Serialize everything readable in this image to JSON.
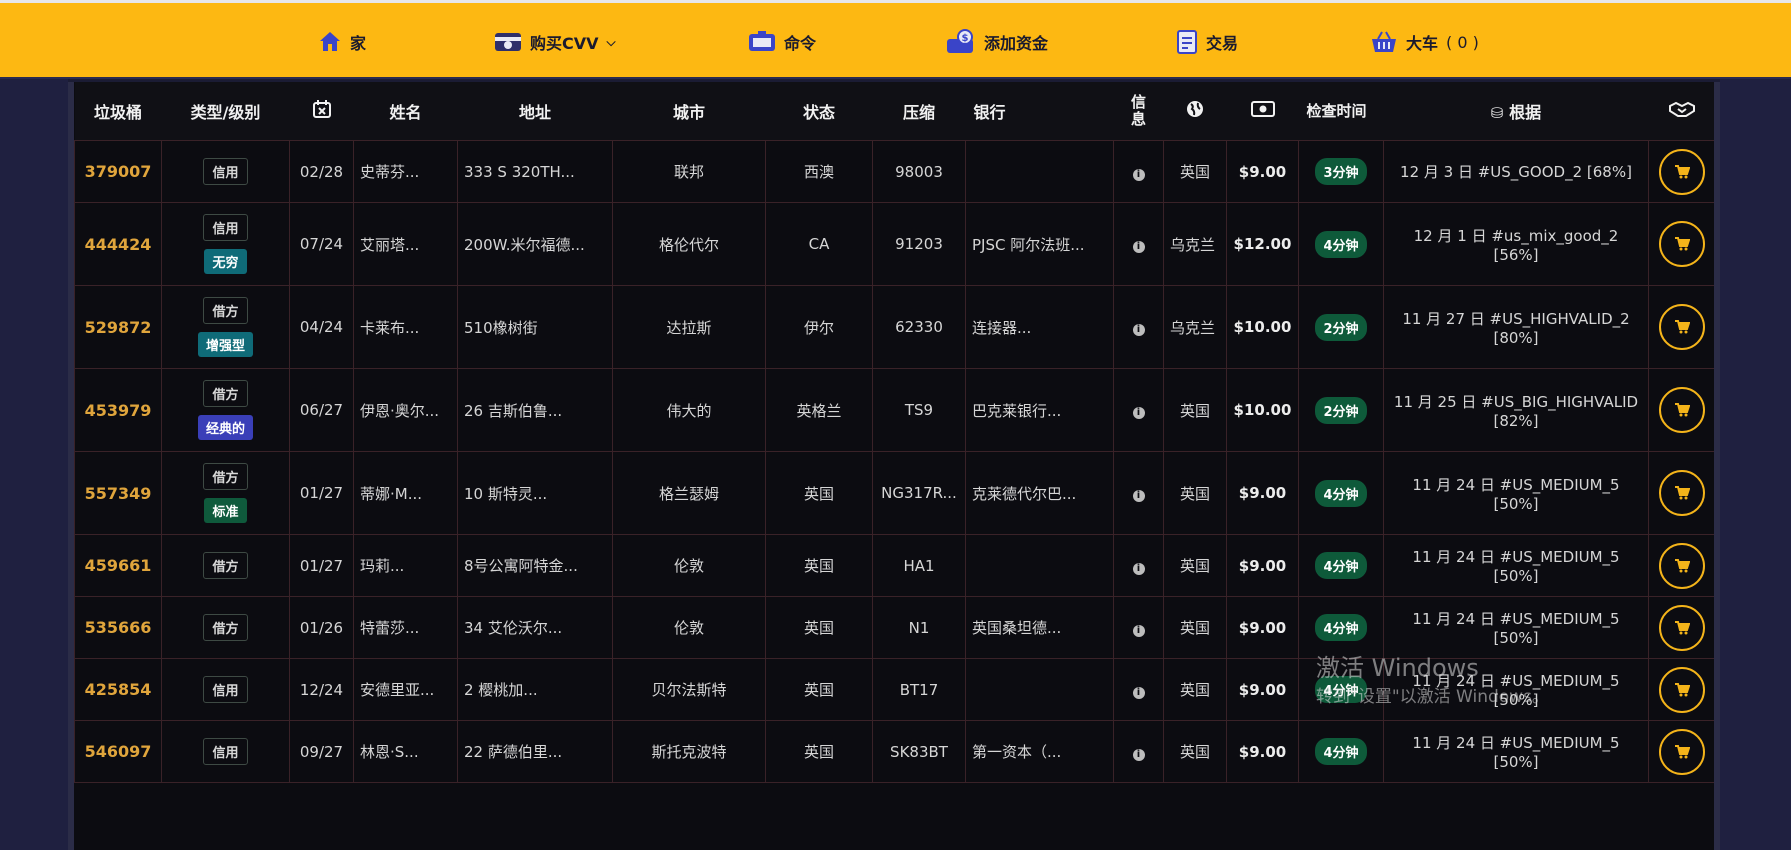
{
  "nav": {
    "home": "家",
    "buy_cvv": "购买CVV",
    "orders": "命令",
    "add_funds": "添加资金",
    "transactions": "交易",
    "cart": "大车",
    "cart_count": "( 0 )"
  },
  "table": {
    "headers": {
      "bin": "垃圾桶",
      "type_level": "类型/级别",
      "name": "姓名",
      "address": "地址",
      "city": "城市",
      "state": "状态",
      "zip": "压缩",
      "bank": "银行",
      "info": "信息",
      "checked": "检查时间",
      "base": "根据"
    },
    "rows": [
      {
        "bin": "379007",
        "type": "信用",
        "level": "",
        "level_color": "",
        "exp": "02/28",
        "name": "史蒂芬...",
        "address": "333 S 320TH...",
        "city": "联邦",
        "state": "西澳",
        "zip": "98003",
        "bank": "",
        "country": "英国",
        "price": "$9.00",
        "checked": "3分钟",
        "base": "12 月 3 日 #US_GOOD_2 [68%]"
      },
      {
        "bin": "444424",
        "type": "信用",
        "level": "无穷",
        "level_color": "#0f6b78",
        "exp": "07/24",
        "name": "艾丽塔...",
        "address": "200W.米尔福德...",
        "city": "格伦代尔",
        "state": "CA",
        "zip": "91203",
        "bank": "PJSC 阿尔法班...",
        "country": "乌克兰",
        "price": "$12.00",
        "checked": "4分钟",
        "base": "12 月 1 日 #us_mix_good_2 [56%]"
      },
      {
        "bin": "529872",
        "type": "借方",
        "level": "增强型",
        "level_color": "#0f6b78",
        "exp": "04/24",
        "name": "卡莱布...",
        "address": "510橡树街",
        "city": "达拉斯",
        "state": "伊尔",
        "zip": "62330",
        "bank": "连接器...",
        "country": "乌克兰",
        "price": "$10.00",
        "checked": "2分钟",
        "base": "11 月 27 日 #US_HIGHVALID_2 [80%]"
      },
      {
        "bin": "453979",
        "type": "借方",
        "level": "经典的",
        "level_color": "#3a3fb8",
        "exp": "06/27",
        "name": "伊恩·奥尔...",
        "address": "26 吉斯伯鲁...",
        "city": "伟大的",
        "state": "英格兰",
        "zip": "TS9",
        "bank": "巴克莱银行...",
        "country": "英国",
        "price": "$10.00",
        "checked": "2分钟",
        "base": "11 月 25 日 #US_BIG_HIGHVALID [82%]"
      },
      {
        "bin": "557349",
        "type": "借方",
        "level": "标准",
        "level_color": "#0f5a3c",
        "exp": "01/27",
        "name": "蒂娜·M...",
        "address": "10 斯特灵...",
        "city": "格兰瑟姆",
        "state": "英国",
        "zip": "NG317R...",
        "bank": "克莱德代尔巴...",
        "country": "英国",
        "price": "$9.00",
        "checked": "4分钟",
        "base": "11 月 24 日 #US_MEDIUM_5 [50%]"
      },
      {
        "bin": "459661",
        "type": "借方",
        "level": "",
        "level_color": "",
        "exp": "01/27",
        "name": "玛莉...",
        "address": "8号公寓阿特金...",
        "city": "伦敦",
        "state": "英国",
        "zip": "HA1",
        "bank": "",
        "country": "英国",
        "price": "$9.00",
        "checked": "4分钟",
        "base": "11 月 24 日 #US_MEDIUM_5 [50%]"
      },
      {
        "bin": "535666",
        "type": "借方",
        "level": "",
        "level_color": "",
        "exp": "01/26",
        "name": "特蕾莎...",
        "address": "34 艾伦沃尔...",
        "city": "伦敦",
        "state": "英国",
        "zip": "N1",
        "bank": "英国桑坦德...",
        "country": "英国",
        "price": "$9.00",
        "checked": "4分钟",
        "base": "11 月 24 日 #US_MEDIUM_5 [50%]"
      },
      {
        "bin": "425854",
        "type": "信用",
        "level": "",
        "level_color": "",
        "exp": "12/24",
        "name": "安德里亚...",
        "address": "2 樱桃加...",
        "city": "贝尔法斯特",
        "state": "英国",
        "zip": "BT17",
        "bank": "",
        "country": "英国",
        "price": "$9.00",
        "checked": "4分钟",
        "base": "11 月 24 日 #US_MEDIUM_5 [50%]"
      },
      {
        "bin": "546097",
        "type": "信用",
        "level": "",
        "level_color": "",
        "exp": "09/27",
        "name": "林恩·S...",
        "address": "22 萨德伯里...",
        "city": "斯托克波特",
        "state": "英国",
        "zip": "SK83BT",
        "bank": "第一资本（...",
        "country": "英国",
        "price": "$9.00",
        "checked": "4分钟",
        "base": "11 月 24 日 #US_MEDIUM_5 [50%]"
      }
    ]
  },
  "watermark": {
    "line1": "激活 Windows",
    "line2": "转到\"设置\"以激活 Windows。"
  },
  "colors": {
    "nav_bg": "#fdb812",
    "bin_text": "#e0a53c",
    "cart_ring": "#f4b41a",
    "time_badge": "#0e5a3a"
  }
}
